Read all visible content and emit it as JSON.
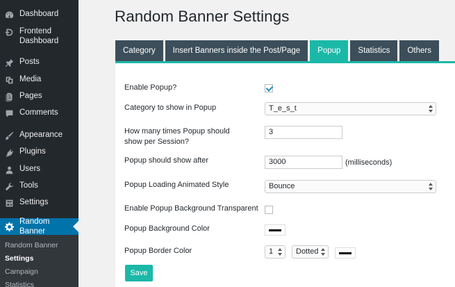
{
  "sidebar": {
    "items": [
      {
        "label": "Dashboard",
        "icon": "dashboard-icon"
      },
      {
        "label": "Frontend Dashboard",
        "icon": "frontend-dashboard-icon"
      },
      {
        "label": "Posts",
        "icon": "pin-icon"
      },
      {
        "label": "Media",
        "icon": "media-icon"
      },
      {
        "label": "Pages",
        "icon": "pages-icon"
      },
      {
        "label": "Comments",
        "icon": "comments-icon"
      },
      {
        "label": "Appearance",
        "icon": "paintbrush-icon"
      },
      {
        "label": "Plugins",
        "icon": "plugins-icon"
      },
      {
        "label": "Users",
        "icon": "users-icon"
      },
      {
        "label": "Tools",
        "icon": "wrench-icon"
      },
      {
        "label": "Settings",
        "icon": "settings-icon"
      },
      {
        "label": "Random Banner",
        "icon": "gear-icon"
      }
    ],
    "submenu": [
      "Random Banner",
      "Settings",
      "Campaign",
      "Statistics"
    ]
  },
  "page": {
    "title": "Random Banner Settings"
  },
  "tabs": [
    "Category",
    "Insert Banners inside the Post/Page",
    "Popup",
    "Statistics",
    "Others"
  ],
  "form": {
    "enable_popup_label": "Enable Popup?",
    "category_label": "Category to show in Popup",
    "category_value": "T_e_s_t",
    "times_label": "How many times Popup should show per Session?",
    "times_value": "3",
    "after_label": "Popup should show after",
    "after_value": "3000",
    "after_unit": "(milliseconds)",
    "anim_label": "Popup Loading Animated Style",
    "anim_value": "Bounce",
    "transparent_label": "Enable Popup Background Transparent",
    "bg_color_label": "Popup Background Color",
    "border_color_label": "Popup Border Color",
    "border_width_value": "1",
    "border_style_value": "Dotted",
    "save_label": "Save"
  },
  "colors": {
    "sidebar_bg": "#23282d",
    "active_menu": "#0073aa",
    "tab_bg": "#3c4e5a",
    "tab_active": "#1bb8a8",
    "swatch": "#000000"
  }
}
